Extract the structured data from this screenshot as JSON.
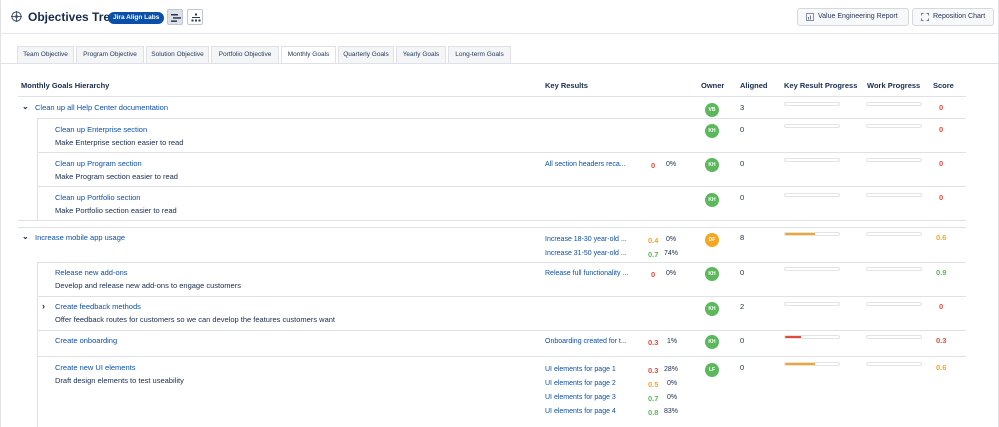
{
  "header": {
    "title": "Objectives Tree",
    "badge": "Jira Align Labs",
    "buttons": {
      "value_engineering": "Value Engineering Report",
      "reposition": "Reposition Chart"
    }
  },
  "tabs": [
    "Team Objective",
    "Program Objective",
    "Solution Objective",
    "Portfolio Objective",
    "Monthly Goals",
    "Quarterly Goals",
    "Yearly Goals",
    "Long-term Goals"
  ],
  "active_tab": "Monthly Goals",
  "columns": {
    "hierarchy": "Monthly Goals Hierarchy",
    "key_results": "Key Results",
    "owner": "Owner",
    "aligned": "Aligned",
    "kr_progress": "Key Result Progress",
    "work_progress": "Work Progress",
    "score": "Score"
  },
  "colors": {
    "red": "#e5493a",
    "orange": "#f5a623",
    "green": "#5cb85c",
    "link": "#0b4fa8"
  },
  "rows": [
    {
      "title": "Clean up all Help Center documentation",
      "desc": "",
      "owner": "VB",
      "aligned": "3",
      "score": "0",
      "kr_progress": 0,
      "key_results": []
    },
    {
      "title": "Clean up Enterprise section",
      "desc": "Make Enterprise section easier to read",
      "owner": "KH",
      "aligned": "0",
      "score": "0",
      "kr_progress": 0,
      "key_results": []
    },
    {
      "title": "Clean up Program section",
      "desc": "Make Program section easier to read",
      "owner": "KH",
      "aligned": "0",
      "score": "0",
      "kr_progress": 0,
      "key_results": [
        {
          "name": "All section headers reca...",
          "score": "0",
          "pct": "0%"
        }
      ]
    },
    {
      "title": "Clean up Portfolio section",
      "desc": "Make Portfolio section easier to read",
      "owner": "KH",
      "aligned": "0",
      "score": "0",
      "kr_progress": 0,
      "key_results": []
    },
    {
      "title": "Increase mobile app usage",
      "desc": "",
      "owner": "DF",
      "aligned": "8",
      "score": "0.6",
      "kr_progress": 0.55,
      "key_results": [
        {
          "name": "Increase 18-30 year-old ...",
          "score": "0.4",
          "pct": "0%"
        },
        {
          "name": "Increase 31-50 year-old ...",
          "score": "0.7",
          "pct": "74%"
        }
      ]
    },
    {
      "title": "Release new add-ons",
      "desc": "Develop and release new add-ons to engage customers",
      "owner": "KH",
      "aligned": "0",
      "score": "0.9",
      "kr_progress": 0,
      "key_results": [
        {
          "name": "Release full functionality ...",
          "score": "0",
          "pct": "0%"
        }
      ]
    },
    {
      "title": "Create feedback methods",
      "desc": "Offer feedback routes for customers so we can develop the features customers want",
      "owner": "KH",
      "aligned": "2",
      "score": "0",
      "kr_progress": 0,
      "key_results": []
    },
    {
      "title": "Create onboarding",
      "desc": "",
      "owner": "KH",
      "aligned": "0",
      "score": "0.3",
      "kr_progress": 0.3,
      "key_results": [
        {
          "name": "Onboarding created for t...",
          "score": "0.3",
          "pct": "1%"
        }
      ]
    },
    {
      "title": "Create new UI elements",
      "desc": "Draft design elements to test useability",
      "owner": "LF",
      "aligned": "0",
      "score": "0.6",
      "kr_progress": 0.55,
      "key_results": [
        {
          "name": "UI elements for page 1",
          "score": "0.3",
          "pct": "28%"
        },
        {
          "name": "UI elements for page 2",
          "score": "0.5",
          "pct": "0%"
        },
        {
          "name": "UI elements for page 3",
          "score": "0.7",
          "pct": "0%"
        },
        {
          "name": "UI elements for page 4",
          "score": "0.8",
          "pct": "83%"
        }
      ]
    }
  ]
}
